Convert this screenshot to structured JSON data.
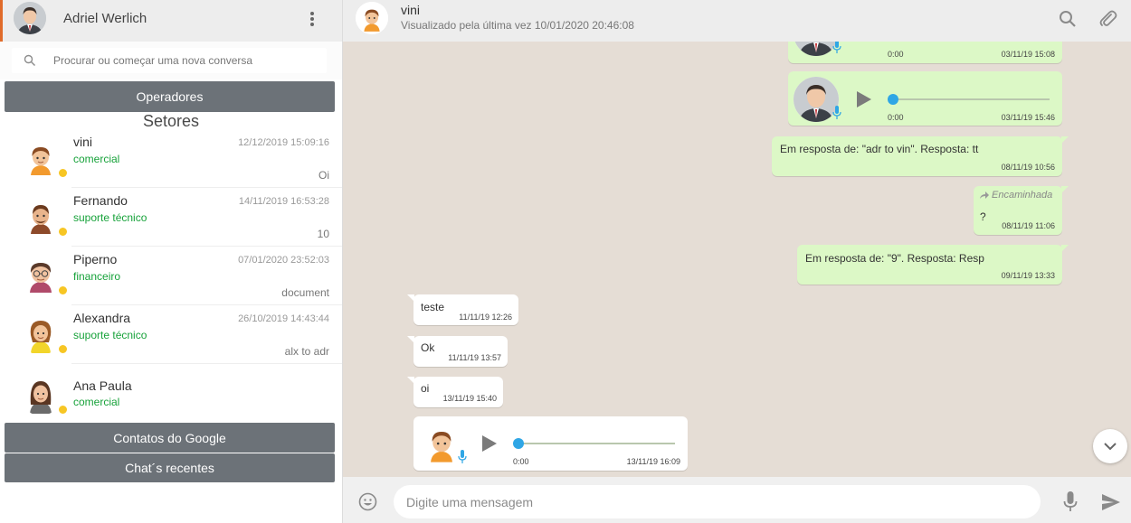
{
  "sidebar": {
    "user_name": "Adriel Werlich",
    "search_placeholder": "Procurar ou começar uma nova conversa",
    "operators_label": "Operadores",
    "sectors_title": "Setores",
    "google_contacts_label": "Contatos do Google",
    "recent_chats_label": "Chat´s recentes",
    "contacts": [
      {
        "name": "vini",
        "sector": "comercial",
        "time": "12/12/2019 15:09:16",
        "preview": "Oi"
      },
      {
        "name": "Fernando",
        "sector": "suporte técnico",
        "time": "14/11/2019 16:53:28",
        "preview": "10"
      },
      {
        "name": "Piperno",
        "sector": "financeiro",
        "time": "07/01/2020 23:52:03",
        "preview": "document"
      },
      {
        "name": "Alexandra",
        "sector": "suporte técnico",
        "time": "26/10/2019 14:43:44",
        "preview": "alx to adr"
      },
      {
        "name": "Ana Paula",
        "sector": "comercial",
        "time": "",
        "preview": ""
      }
    ]
  },
  "chat": {
    "name": "vini",
    "status": "Visualizado pela última vez 10/01/2020 20:46:08",
    "messages": [
      {
        "type": "audio",
        "direction": "out",
        "position": "0:00",
        "time": "03/11/19 15:08"
      },
      {
        "type": "audio",
        "direction": "out",
        "position": "0:00",
        "time": "03/11/19 15:46"
      },
      {
        "type": "text",
        "direction": "out",
        "text": "Em resposta de: \"adr to vin\". Resposta: tt",
        "time": "08/11/19 10:56"
      },
      {
        "type": "text",
        "direction": "out",
        "forwarded": "Encaminhada",
        "text": "?",
        "time": "08/11/19 11:06"
      },
      {
        "type": "text",
        "direction": "out",
        "text": "Em resposta de: \"9\". Resposta: Resp",
        "time": "09/11/19 13:33"
      },
      {
        "type": "text",
        "direction": "in",
        "text": "teste",
        "time": "11/11/19 12:26"
      },
      {
        "type": "text",
        "direction": "in",
        "text": "Ok",
        "time": "11/11/19 13:57"
      },
      {
        "type": "text",
        "direction": "in",
        "text": "oi",
        "time": "13/11/19 15:40"
      },
      {
        "type": "audio",
        "direction": "in",
        "position": "0:00",
        "time": "13/11/19 16:09"
      }
    ]
  },
  "composer": {
    "placeholder": "Digite uma mensagem"
  },
  "colors": {
    "outgoing": "#dcf8c6",
    "incoming": "#ffffff",
    "chat_bg": "#e5ddd5",
    "sector_text": "#17a23a",
    "status_dot": "#f7c624",
    "audio_knob": "#2fa6e5",
    "gray_button": "#6c7278"
  },
  "icons": [
    "kebab-menu-icon",
    "search-icon",
    "paperclip-icon",
    "play-icon",
    "microphone-icon",
    "emoji-icon",
    "send-icon",
    "chevron-down-icon"
  ]
}
